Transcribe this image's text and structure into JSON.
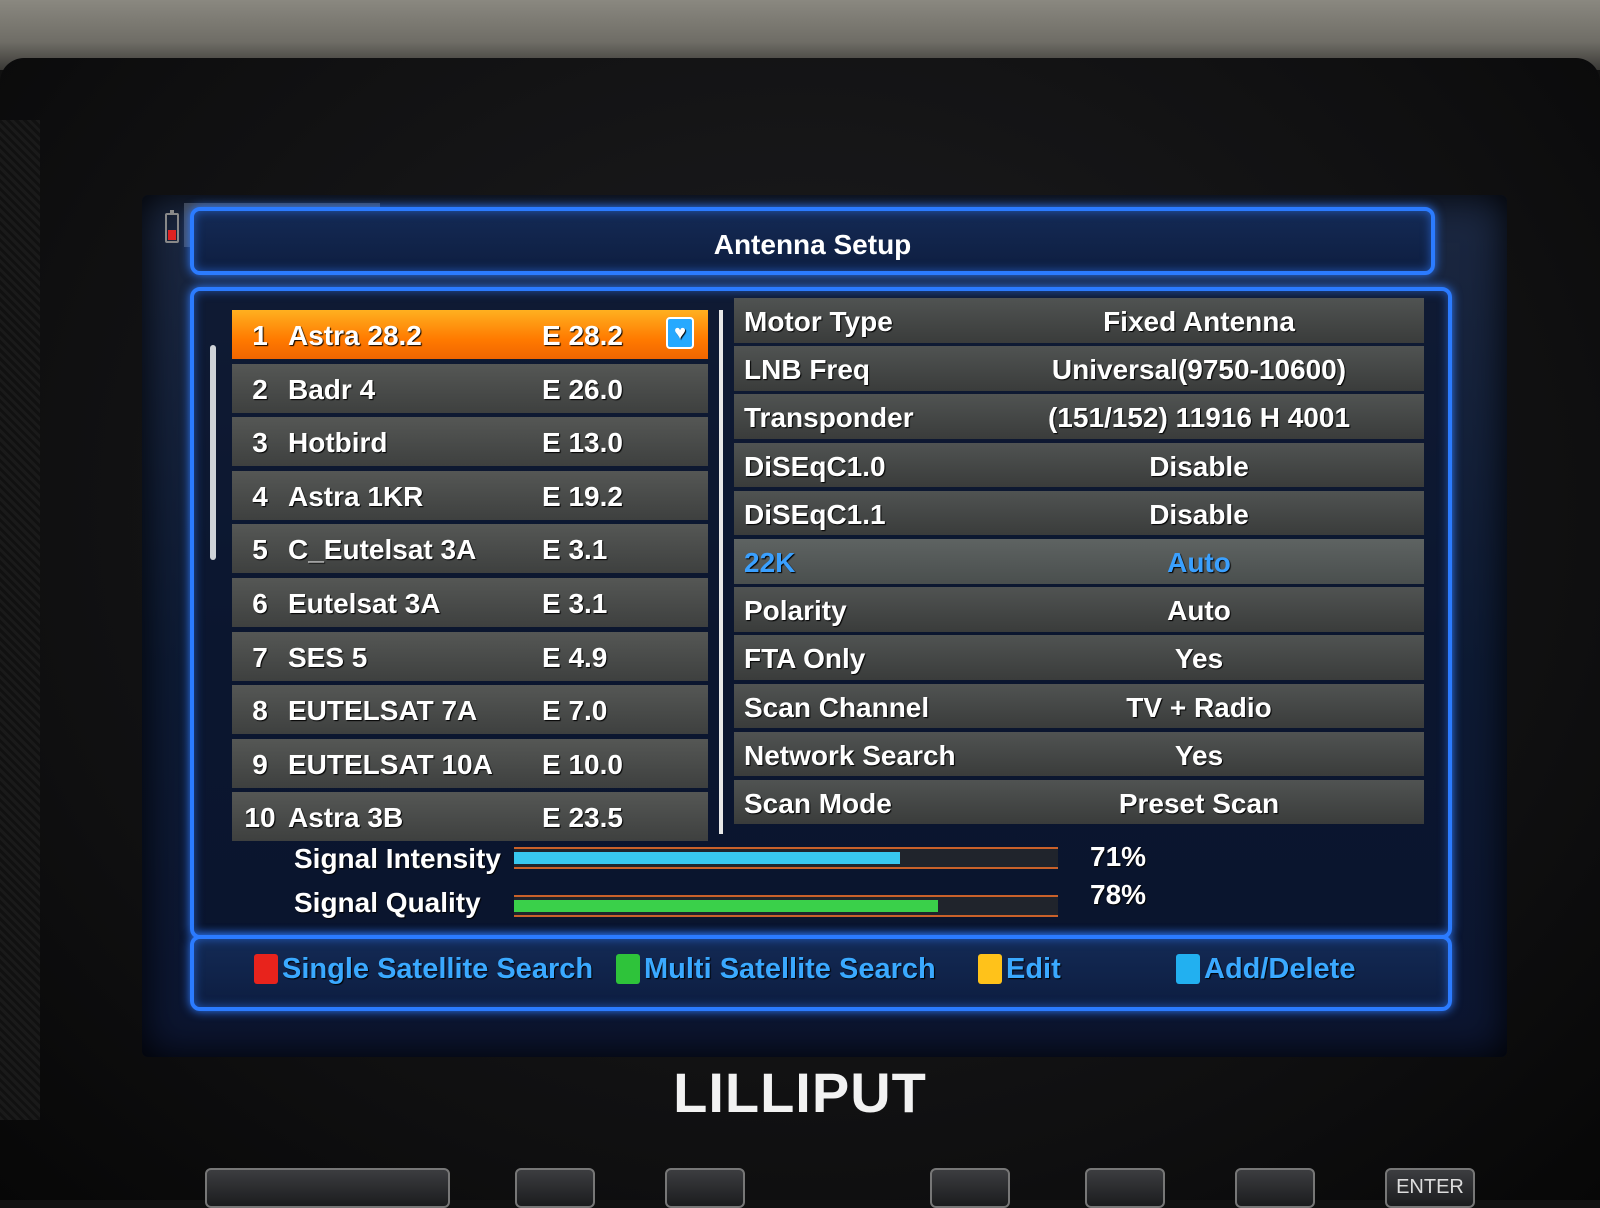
{
  "title": "Antenna Setup",
  "satellites": [
    {
      "num": "1",
      "name": "Astra 28.2",
      "pos": "E 28.2"
    },
    {
      "num": "2",
      "name": "Badr 4",
      "pos": "E 26.0"
    },
    {
      "num": "3",
      "name": "Hotbird",
      "pos": "E 13.0"
    },
    {
      "num": "4",
      "name": "Astra 1KR",
      "pos": "E 19.2"
    },
    {
      "num": "5",
      "name": "C_Eutelsat 3A",
      "pos": "E 3.1"
    },
    {
      "num": "6",
      "name": "Eutelsat 3A",
      "pos": "E 3.1"
    },
    {
      "num": "7",
      "name": "SES 5",
      "pos": "E 4.9"
    },
    {
      "num": "8",
      "name": "EUTELSAT 7A",
      "pos": "E 7.0"
    },
    {
      "num": "9",
      "name": "EUTELSAT 10A",
      "pos": "E 10.0"
    },
    {
      "num": "10",
      "name": "Astra 3B",
      "pos": "E 23.5"
    }
  ],
  "settings": [
    {
      "label": "Motor Type",
      "value": "Fixed Antenna"
    },
    {
      "label": "LNB Freq",
      "value": "Universal(9750-10600)"
    },
    {
      "label": "Transponder",
      "value": "(151/152) 11916 H 4001"
    },
    {
      "label": "DiSEqC1.0",
      "value": "Disable"
    },
    {
      "label": "DiSEqC1.1",
      "value": "Disable"
    },
    {
      "label": "22K",
      "value": "Auto"
    },
    {
      "label": "Polarity",
      "value": "Auto"
    },
    {
      "label": "FTA Only",
      "value": "Yes"
    },
    {
      "label": "Scan Channel",
      "value": "TV + Radio"
    },
    {
      "label": "Network Search",
      "value": "Yes"
    },
    {
      "label": "Scan Mode",
      "value": "Preset Scan"
    }
  ],
  "signal": {
    "intensity_label": "Signal Intensity",
    "intensity_pct": "71%",
    "intensity_value": 0.71,
    "quality_label": "Signal Quality",
    "quality_pct": "78%",
    "quality_value": 0.78
  },
  "footer": {
    "red_label": "Single Satellite Search",
    "green_label": "Multi Satellite Search",
    "yellow_label": "Edit",
    "blue_label": "Add/Delete"
  },
  "brand": "LILLIPUT",
  "hw_buttons": {
    "enter": "ENTER"
  },
  "colors": {
    "accent": "#2b7bff",
    "selected": "#ff8a00",
    "intensity_bar": "#38c8f0",
    "quality_bar": "#3ad04a"
  }
}
